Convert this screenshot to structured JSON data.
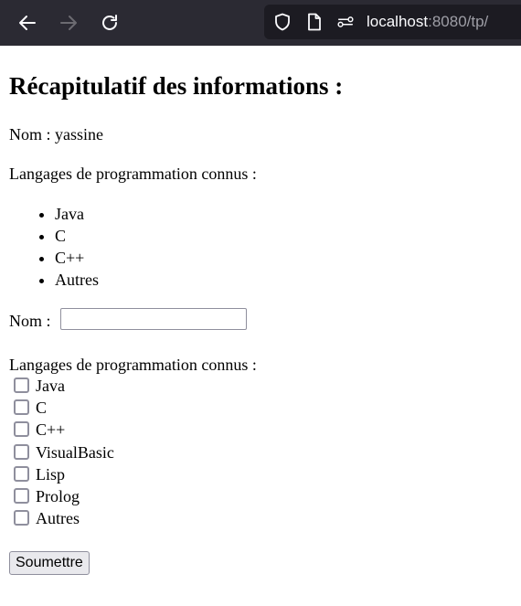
{
  "browser": {
    "url_host": "localhost",
    "url_rest": ":8080/tp/",
    "icons": [
      "back-icon",
      "forward-icon",
      "reload-icon",
      "shield-icon",
      "page-icon",
      "permissions-icon"
    ]
  },
  "page": {
    "title": "Récapitulatif des informations :",
    "summary_name": "Nom : yassine",
    "summary_langs_label": "Langages de programmation connus :",
    "summary_langs": [
      "Java",
      "C",
      "C++",
      "Autres"
    ],
    "form": {
      "name_label": "Nom :",
      "name_value": "",
      "langs_label": "Langages de programmation connus :",
      "options": [
        "Java",
        "C",
        "C++",
        "VisualBasic",
        "Lisp",
        "Prolog",
        "Autres"
      ],
      "submit_label": "Soumettre"
    }
  }
}
